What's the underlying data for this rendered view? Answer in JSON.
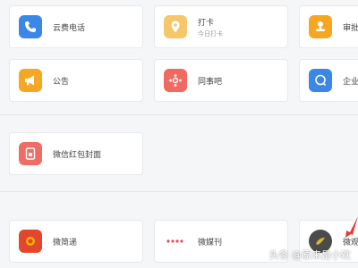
{
  "rows": {
    "row1": [
      {
        "label": "云费电话",
        "sub": "",
        "icon": "phone-icon",
        "color": "#3a87e8"
      },
      {
        "label": "打卡",
        "sub": "今日打卡",
        "icon": "location-pin-icon",
        "color": "#f5c76a"
      },
      {
        "label": "审批",
        "sub": "",
        "icon": "stamp-icon",
        "color": "#f5a623"
      }
    ],
    "row2": [
      {
        "label": "公告",
        "sub": "",
        "icon": "megaphone-icon",
        "color": "#f5a623"
      },
      {
        "label": "同事吧",
        "sub": "",
        "icon": "hub-icon",
        "color": "#f06a62"
      },
      {
        "label": "企业邮",
        "sub": "",
        "icon": "chat-bubble-icon",
        "color": "#3a87e8"
      }
    ],
    "row3": [
      {
        "label": "微信红包封面",
        "sub": "",
        "icon": "red-packet-icon",
        "color": "#ee6e66"
      }
    ],
    "row4": [
      {
        "label": "微简递",
        "sub": "",
        "icon": "app-logo-icon",
        "color": "#e2462e"
      },
      {
        "label": "微媒刊",
        "sub": "",
        "icon": "dots-icon",
        "color": "#e94c57"
      },
      {
        "label": "微观",
        "sub": "",
        "icon": "app-round-logo-icon",
        "color": "#4b4b4b"
      }
    ]
  },
  "watermark": "头条 @原来是小欢",
  "colors": {
    "background": "#f5f6f8",
    "card": "#ffffff",
    "arrow": "#e53935"
  }
}
